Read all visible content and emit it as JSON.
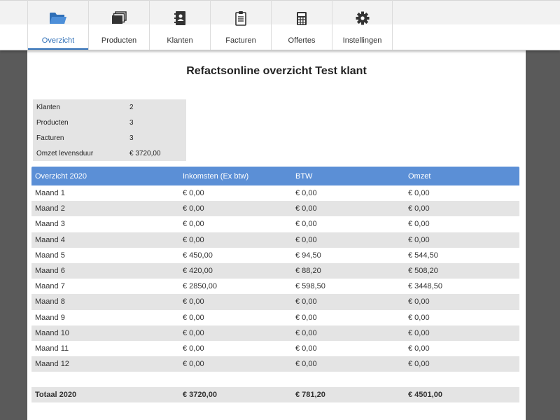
{
  "nav": [
    {
      "label": "Overzicht",
      "icon": "folder-icon",
      "active": true
    },
    {
      "label": "Producten",
      "icon": "stack-icon",
      "active": false
    },
    {
      "label": "Klanten",
      "icon": "address-book-icon",
      "active": false
    },
    {
      "label": "Facturen",
      "icon": "clipboard-icon",
      "active": false
    },
    {
      "label": "Offertes",
      "icon": "calculator-icon",
      "active": false
    },
    {
      "label": "Instellingen",
      "icon": "gear-icon",
      "active": false
    }
  ],
  "page": {
    "title": "Refactsonline overzicht Test klant"
  },
  "summary": [
    {
      "label": "Klanten",
      "value": "2"
    },
    {
      "label": "Producten",
      "value": "3"
    },
    {
      "label": "Facturen",
      "value": "3"
    },
    {
      "label": "Omzet levensduur",
      "value": "€ 3720,00"
    }
  ],
  "table": {
    "headers": [
      "Overzicht 2020",
      "Inkomsten (Ex btw)",
      "BTW",
      "Omzet"
    ],
    "rows": [
      [
        "Maand 1",
        "€ 0,00",
        "€ 0,00",
        "€ 0,00"
      ],
      [
        "Maand 2",
        "€ 0,00",
        "€ 0,00",
        "€ 0,00"
      ],
      [
        "Maand 3",
        "€ 0,00",
        "€ 0,00",
        "€ 0,00"
      ],
      [
        "Maand 4",
        "€ 0,00",
        "€ 0,00",
        "€ 0,00"
      ],
      [
        "Maand 5",
        "€ 450,00",
        "€ 94,50",
        "€ 544,50"
      ],
      [
        "Maand 6",
        "€ 420,00",
        "€ 88,20",
        "€ 508,20"
      ],
      [
        "Maand 7",
        "€ 2850,00",
        "€ 598,50",
        "€ 3448,50"
      ],
      [
        "Maand 8",
        "€ 0,00",
        "€ 0,00",
        "€ 0,00"
      ],
      [
        "Maand 9",
        "€ 0,00",
        "€ 0,00",
        "€ 0,00"
      ],
      [
        "Maand 10",
        "€ 0,00",
        "€ 0,00",
        "€ 0,00"
      ],
      [
        "Maand 11",
        "€ 0,00",
        "€ 0,00",
        "€ 0,00"
      ],
      [
        "Maand 12",
        "€ 0,00",
        "€ 0,00",
        "€ 0,00"
      ]
    ],
    "total": [
      "Totaal 2020",
      "€ 3720,00",
      "€ 781,20",
      "€ 4501,00"
    ]
  },
  "colors": {
    "accent": "#2f6fb7",
    "header_bg": "#5b8fd6",
    "stripe": "#e4e4e4",
    "backdrop": "#5a5a5a"
  }
}
